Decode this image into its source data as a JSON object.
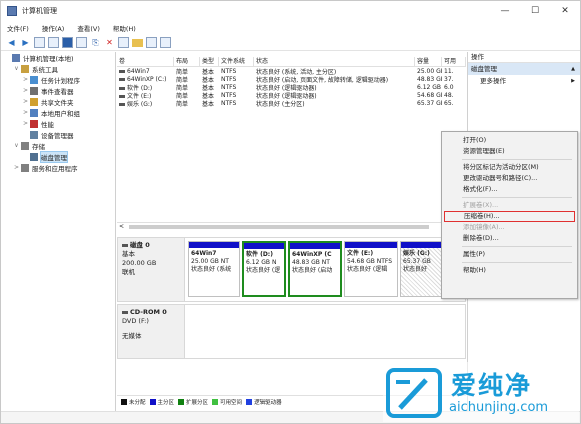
{
  "window": {
    "title": "计算机管理",
    "minimize": "—",
    "maximize": "☐",
    "close": "✕"
  },
  "menu": [
    "文件(F)",
    "操作(A)",
    "查看(V)",
    "帮助(H)"
  ],
  "tree": [
    {
      "label": "计算机管理(本地)",
      "level": 0,
      "exp": "",
      "icon": "#5a7ab0"
    },
    {
      "label": "系统工具",
      "level": 1,
      "exp": "∨",
      "icon": "#c8a040"
    },
    {
      "label": "任务计划程序",
      "level": 2,
      "exp": ">",
      "icon": "#4a8fd0"
    },
    {
      "label": "事件查看器",
      "level": 2,
      "exp": ">",
      "icon": "#707070"
    },
    {
      "label": "共享文件夹",
      "level": 2,
      "exp": ">",
      "icon": "#d0a030"
    },
    {
      "label": "本地用户和组",
      "level": 2,
      "exp": ">",
      "icon": "#5080c0"
    },
    {
      "label": "性能",
      "level": 2,
      "exp": ">",
      "icon": "#c03030"
    },
    {
      "label": "设备管理器",
      "level": 2,
      "exp": "",
      "icon": "#6080a0"
    },
    {
      "label": "存储",
      "level": 1,
      "exp": "∨",
      "icon": "#808080"
    },
    {
      "label": "磁盘管理",
      "level": 2,
      "exp": "",
      "icon": "#507090",
      "selected": true
    },
    {
      "label": "服务和应用程序",
      "level": 1,
      "exp": ">",
      "icon": "#808080"
    }
  ],
  "volumes": {
    "headers": [
      "卷",
      "布局",
      "类型",
      "文件系统",
      "状态",
      "容量",
      "可用"
    ],
    "rows": [
      [
        "64Win7",
        "简单",
        "基本",
        "NTFS",
        "状态良好 (系统, 活动, 主分区)",
        "25.00 GB",
        "11."
      ],
      [
        "64WinXP (C:)",
        "简单",
        "基本",
        "NTFS",
        "状态良好 (启动, 页面文件, 故障转储, 逻辑驱动器)",
        "48.83 GB",
        "37."
      ],
      [
        "软件 (D:)",
        "简单",
        "基本",
        "NTFS",
        "状态良好 (逻辑驱动器)",
        "6.12 GB",
        "6.0"
      ],
      [
        "文件 (E:)",
        "简单",
        "基本",
        "NTFS",
        "状态良好 (逻辑驱动器)",
        "54.68 GB",
        "48."
      ],
      [
        "娱乐 (G:)",
        "简单",
        "基本",
        "NTFS",
        "状态良好 (主分区)",
        "65.37 GB",
        "65."
      ]
    ]
  },
  "scroll_left": "<",
  "disk0": {
    "name": "磁盘 0",
    "type": "基本",
    "size": "200.00 GB",
    "state": "联机"
  },
  "disk0_parts": [
    {
      "name": "64Win7",
      "size": "25.00 GB NT",
      "status": "状态良好 (系统",
      "bar": "#1010c8"
    },
    {
      "name": "软件 (D:)",
      "size": "6.12 GB N",
      "status": "状态良好 (逻",
      "bar": "#1010c8",
      "hl": true
    },
    {
      "name": "64WinXP (C",
      "size": "48.83 GB NT",
      "status": "状态良好 (启动",
      "bar": "#1010c8",
      "hl": true
    },
    {
      "name": "文件 (E:)",
      "size": "54.68 GB NTFS",
      "status": "状态良好 (逻辑",
      "bar": "#1010c8"
    },
    {
      "name": "娱乐 (G:)",
      "size": "65.37 GB",
      "status": "状态良好",
      "bar": "#1010c8"
    }
  ],
  "cdrom": {
    "name": "CD-ROM 0",
    "type": "DVD (F:)",
    "state": "无媒体"
  },
  "legend": [
    {
      "label": "未分配",
      "color": "#101010"
    },
    {
      "label": "主分区",
      "color": "#1010c8"
    },
    {
      "label": "扩展分区",
      "color": "#108010"
    },
    {
      "label": "可用空间",
      "color": "#40c040"
    },
    {
      "label": "逻辑驱动器",
      "color": "#2040e0"
    }
  ],
  "actions": {
    "header": "操作",
    "section": "磁盘管理",
    "more": "更多操作",
    "arrow_up": "▲",
    "arrow_right": "▶"
  },
  "context_menu": [
    {
      "label": "打开(O)"
    },
    {
      "label": "资源管理器(E)"
    },
    {
      "sep": true
    },
    {
      "label": "将分区标记为活动分区(M)"
    },
    {
      "label": "更改驱动器号和路径(C)..."
    },
    {
      "label": "格式化(F)..."
    },
    {
      "sep": true
    },
    {
      "label": "扩展卷(X)...",
      "disabled": true
    },
    {
      "label": "压缩卷(H)...",
      "highlight": true
    },
    {
      "label": "添加镜像(A)...",
      "disabled": true
    },
    {
      "label": "删除卷(D)..."
    },
    {
      "sep": true
    },
    {
      "label": "属性(P)"
    },
    {
      "sep": true
    },
    {
      "label": "帮助(H)"
    }
  ],
  "watermark": {
    "name": "爱纯净",
    "url": "aichunjing.com"
  }
}
